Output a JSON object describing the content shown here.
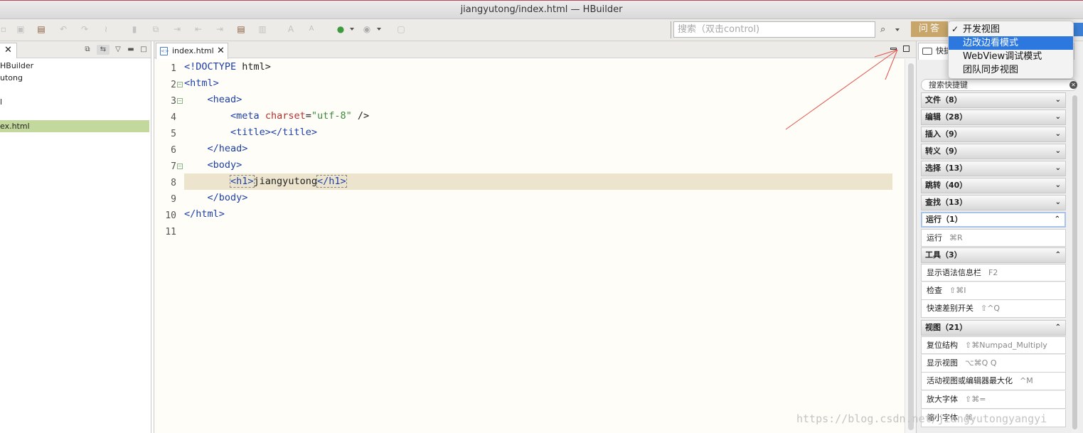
{
  "window": {
    "title": "jiangyutong/index.html — HBuilder"
  },
  "toolbar": {
    "search_placeholder": "搜索（双击control)",
    "search_icon": "⌕",
    "qa_label": "问答"
  },
  "project_panel": {
    "items": [
      "HBuilder",
      "utong",
      "",
      "l",
      "",
      "ex.html"
    ]
  },
  "editor": {
    "tab_label": "index.html",
    "file_icon": "<>",
    "line_numbers": [
      "1",
      "2",
      "3",
      "4",
      "5",
      "6",
      "7",
      "8",
      "9",
      "10",
      "11"
    ]
  },
  "shortcuts_panel": {
    "tab_label": "快捷",
    "search_placeholder": "搜索快捷键",
    "categories": [
      {
        "label": "文件（8）"
      },
      {
        "label": "编辑（28）"
      },
      {
        "label": "插入（9）"
      },
      {
        "label": "转义（9）"
      },
      {
        "label": "选择（13）"
      },
      {
        "label": "跳转（40）"
      },
      {
        "label": "查找（13）"
      },
      {
        "label": "运行（1）"
      },
      {
        "label": "工具（3）"
      },
      {
        "label": "视图（21）"
      }
    ],
    "commands": {
      "run": [
        {
          "label": "运行",
          "shortcut": "⌘R"
        }
      ],
      "tools": [
        {
          "label": "显示语法信息栏",
          "shortcut": "F2"
        },
        {
          "label": "检查",
          "shortcut": "⇧⌘I"
        },
        {
          "label": "快速差别开关",
          "shortcut": "⇧^Q"
        }
      ],
      "view": [
        {
          "label": "复位结构",
          "shortcut": "⇧⌘Numpad_Multiply"
        },
        {
          "label": "显示视图",
          "shortcut": "⌥⌘Q Q"
        },
        {
          "label": "活动视图或编辑器最大化",
          "shortcut": "^M"
        },
        {
          "label": "放大字体",
          "shortcut": "⇧⌘="
        },
        {
          "label": "缩小字体",
          "shortcut": "⌘-"
        }
      ]
    }
  },
  "view_menu": {
    "items": [
      {
        "label": "开发视图",
        "checked": true
      },
      {
        "label": "边改边看模式",
        "highlighted": true
      },
      {
        "label": "WebView调试模式"
      },
      {
        "label": "团队同步视图"
      }
    ],
    "check_mark": "✓"
  },
  "watermark": "https://blog.csdn.net/jiangyutongyangyi",
  "colors": {
    "accent": "#2c78df",
    "current_line": "#ece4cd",
    "selection": "#c3d89c",
    "annotation_arrow": "#e2504a"
  }
}
